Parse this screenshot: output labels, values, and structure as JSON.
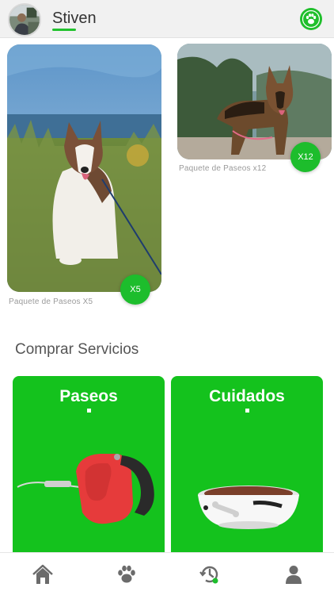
{
  "header": {
    "username": "Stiven",
    "avatar_icon": "user-photo",
    "logo_icon": "paw-logo-icon"
  },
  "packages": [
    {
      "label": "Paquete de Paseos X5",
      "badge": "X5",
      "image": "husky-dog-photo"
    },
    {
      "label": "Paquete de Paseos x12",
      "badge": "X12",
      "image": "german-shepherd-photo"
    }
  ],
  "services": {
    "title": "Comprar Servicios",
    "items": [
      {
        "label": "Paseos",
        "image": "leash-image"
      },
      {
        "label": "Cuidados",
        "image": "dog-bowl-image"
      }
    ]
  },
  "bottom_nav": [
    {
      "icon": "home-icon",
      "active": true
    },
    {
      "icon": "paw-icon",
      "active": false
    },
    {
      "icon": "history-icon",
      "active": false
    },
    {
      "icon": "profile-icon",
      "active": false
    }
  ],
  "colors": {
    "brand_green": "#14c21d",
    "badge_green": "#1dbd2c",
    "nav_gray": "#6b6b6b"
  }
}
